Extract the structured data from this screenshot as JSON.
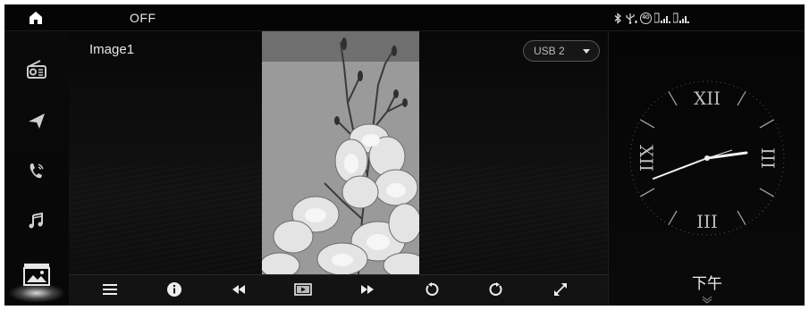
{
  "status_bar": {
    "radio_status": "OFF",
    "icons": [
      "home-icon",
      "bluetooth-icon",
      "usb-icon",
      "4g-icon",
      "signal-sim1-icon",
      "signal-sim2-icon"
    ]
  },
  "sidebar": {
    "items": [
      {
        "name": "radio",
        "icon": "radio-icon",
        "active": false
      },
      {
        "name": "navigation",
        "icon": "navigation-icon",
        "active": false
      },
      {
        "name": "phone",
        "icon": "phone-icon",
        "active": false
      },
      {
        "name": "music",
        "icon": "music-icon",
        "active": false
      },
      {
        "name": "image",
        "icon": "image-icon",
        "active": true
      }
    ]
  },
  "viewer": {
    "image_title": "Image1",
    "source": "USB 2"
  },
  "controls": [
    {
      "name": "menu",
      "icon": "menu-icon"
    },
    {
      "name": "info",
      "icon": "info-icon"
    },
    {
      "name": "previous",
      "icon": "rewind-icon"
    },
    {
      "name": "slideshow",
      "icon": "slideshow-icon"
    },
    {
      "name": "next",
      "icon": "fast-forward-icon"
    },
    {
      "name": "rotate-left",
      "icon": "rotate-left-icon"
    },
    {
      "name": "rotate-right",
      "icon": "rotate-right-icon"
    },
    {
      "name": "fullscreen",
      "icon": "fullscreen-icon"
    }
  ],
  "clock": {
    "ampm": "下午",
    "numerals": {
      "12": "XII",
      "3": "III",
      "6": "III",
      "9": "XII"
    }
  },
  "colors": {
    "background": "#000000",
    "text": "#ffffff",
    "accent": "#ffffff"
  }
}
